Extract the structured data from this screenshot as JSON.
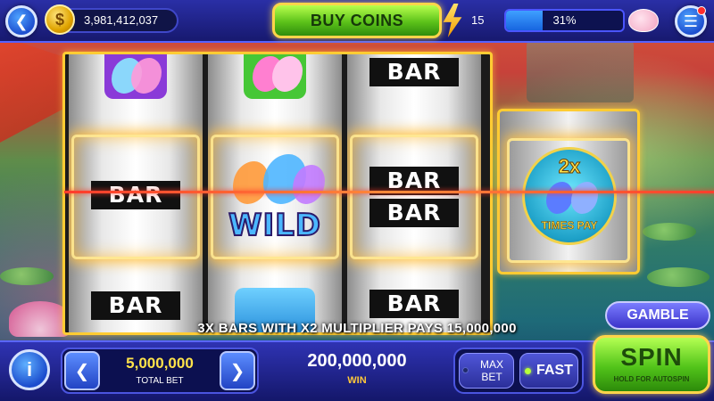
{
  "header": {
    "coin_balance": "3,981,412,037",
    "buy_coins_label": "BUY COINS",
    "level": "15",
    "xp_percent_label": "31%",
    "xp_progress": 0.31,
    "icons": {
      "back": "back-arrow-icon",
      "coin": "coin-icon",
      "bolt": "lightning-bolt-icon",
      "piggy": "piggy-bank-icon",
      "menu": "hamburger-menu-icon"
    },
    "back_glyph": "❮",
    "coin_glyph": "$",
    "menu_glyph": "☰"
  },
  "reels": {
    "symbol_bar": "BAR",
    "wild_label": "WILD",
    "reel1": [
      "butterfly",
      "BAR",
      "BAR"
    ],
    "reel2": [
      "butterfly",
      "WILD",
      "butterfly"
    ],
    "reel3": [
      "BAR",
      "BAR BAR",
      "BAR"
    ]
  },
  "bonus_reel": {
    "multiplier": "2x",
    "label": "TIMES PAY"
  },
  "gamble_label": "GAMBLE",
  "win_message": "3X BARS WITH X2 MULTIPLIER PAYS 15,000,000",
  "footer": {
    "info_label": "i",
    "bet_prev_glyph": "❮",
    "bet_next_glyph": "❯",
    "total_bet_value": "5,000,000",
    "total_bet_label": "TOTAL BET",
    "win_value": "200,000,000",
    "win_label": "WIN",
    "max_bet_label": "MAX BET",
    "fast_label": "FAST",
    "fast_enabled": true,
    "spin_label": "SPIN",
    "spin_sub_label": "HOLD FOR AUTOSPIN"
  },
  "colors": {
    "accent_green": "#5cc21a",
    "accent_gold": "#ffcc33",
    "bar_blue": "#17196f",
    "payline": "#ff3b2b"
  }
}
